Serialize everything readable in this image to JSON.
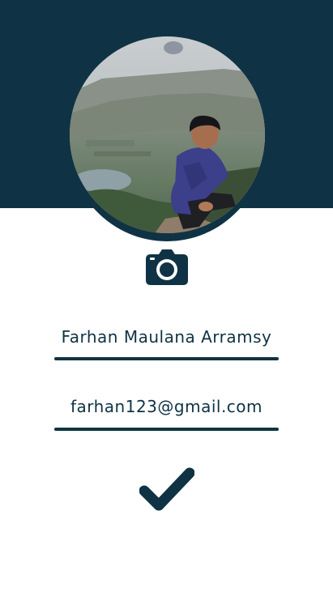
{
  "profile": {
    "name": "Farhan Maulana Arramsy",
    "email": "farhan123@gmail.com"
  },
  "icons": {
    "camera": "camera-icon",
    "confirm": "check-icon"
  },
  "colors": {
    "primary": "#0f3344",
    "background": "#ffffff"
  }
}
